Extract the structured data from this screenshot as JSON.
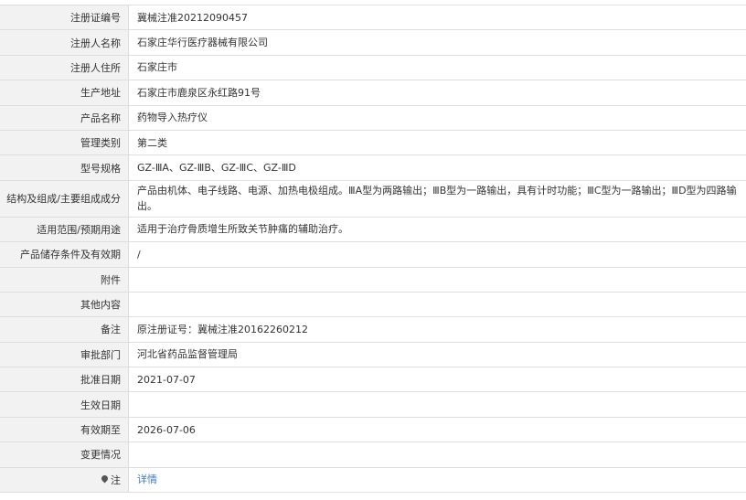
{
  "rows": [
    {
      "label": "注册证编号",
      "value": "冀械注准20212090457"
    },
    {
      "label": "注册人名称",
      "value": "石家庄华行医疗器械有限公司"
    },
    {
      "label": "注册人住所",
      "value": "石家庄市"
    },
    {
      "label": "生产地址",
      "value": "石家庄市鹿泉区永红路91号"
    },
    {
      "label": "产品名称",
      "value": "药物导入热疗仪"
    },
    {
      "label": "管理类别",
      "value": "第二类"
    },
    {
      "label": "型号规格",
      "value": "GZ-ⅢA、GZ-ⅢB、GZ-ⅢC、GZ-ⅢD"
    },
    {
      "label": "结构及组成/主要组成成分",
      "value": "产品由机体、电子线路、电源、加热电极组成。ⅢA型为两路输出；ⅢB型为一路输出，具有计时功能；ⅢC型为一路输出；ⅢD型为四路输出。"
    },
    {
      "label": "适用范围/预期用途",
      "value": "适用于治疗骨质增生所致关节肿痛的辅助治疗。"
    },
    {
      "label": "产品储存条件及有效期",
      "value": "/"
    },
    {
      "label": "附件",
      "value": ""
    },
    {
      "label": "其他内容",
      "value": ""
    },
    {
      "label": "备注",
      "value": "原注册证号：冀械注准20162260212"
    },
    {
      "label": "审批部门",
      "value": "河北省药品监督管理局"
    },
    {
      "label": "批准日期",
      "value": "2021-07-07"
    },
    {
      "label": "生效日期",
      "value": ""
    },
    {
      "label": "有效期至",
      "value": "2026-07-06"
    },
    {
      "label": "变更情况",
      "value": ""
    }
  ],
  "note": {
    "label": "注",
    "icon": "pin-icon",
    "link_text": "详情"
  }
}
